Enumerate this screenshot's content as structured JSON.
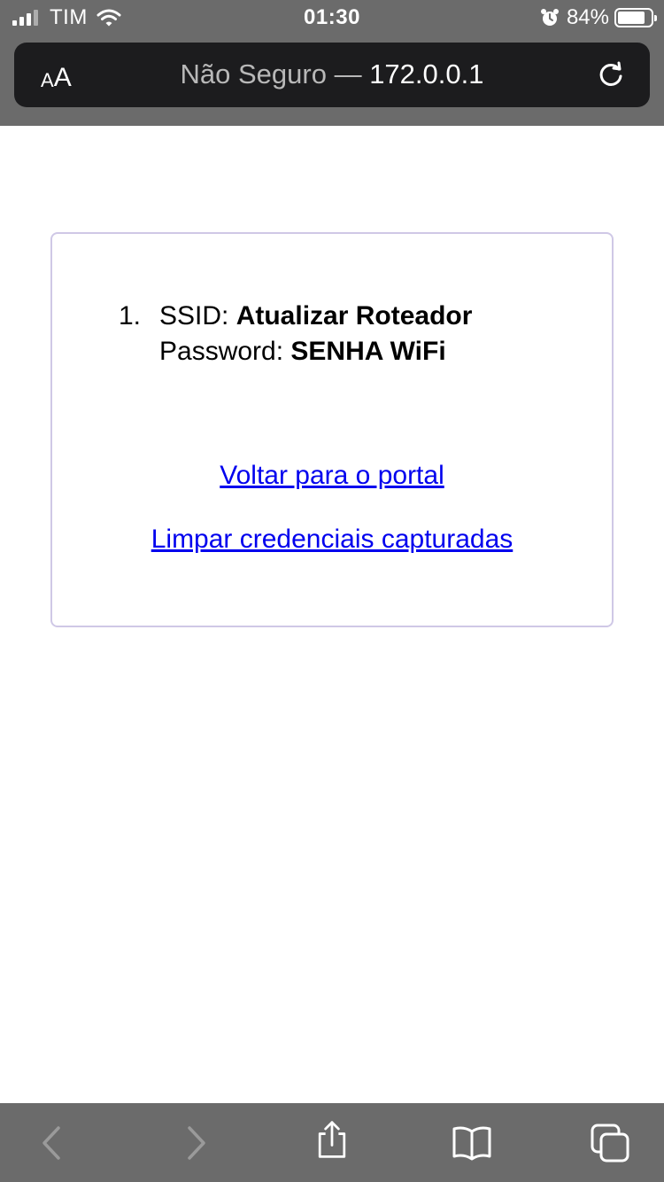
{
  "status_bar": {
    "carrier": "TIM",
    "time": "01:30",
    "battery_percent": "84%",
    "battery_level": 0.84,
    "icons": [
      "signal-icon",
      "wifi-icon",
      "alarm-icon",
      "battery-icon"
    ]
  },
  "address_bar": {
    "text_size_label_small": "A",
    "text_size_label_large": "A",
    "security_label": "Não Seguro — ",
    "host": "172.0.0.1",
    "reload_icon": "reload-icon"
  },
  "page": {
    "credentials": [
      {
        "number": "1.",
        "ssid_label": "SSID: ",
        "ssid_value": "Atualizar Roteador",
        "password_label": "Password: ",
        "password_value": "SENHA WiFi"
      }
    ],
    "back_to_portal_link": "Voltar para o portal",
    "clear_credentials_link": "Limpar credenciais capturadas"
  },
  "toolbar": {
    "icons": [
      "back-icon",
      "forward-icon",
      "share-icon",
      "bookmarks-icon",
      "tabs-icon"
    ]
  },
  "colors": {
    "chrome_background": "#6b6b6b",
    "address_bar_background": "#1c1c1e",
    "link": "#0000ee",
    "card_border": "#cfc8e6"
  }
}
